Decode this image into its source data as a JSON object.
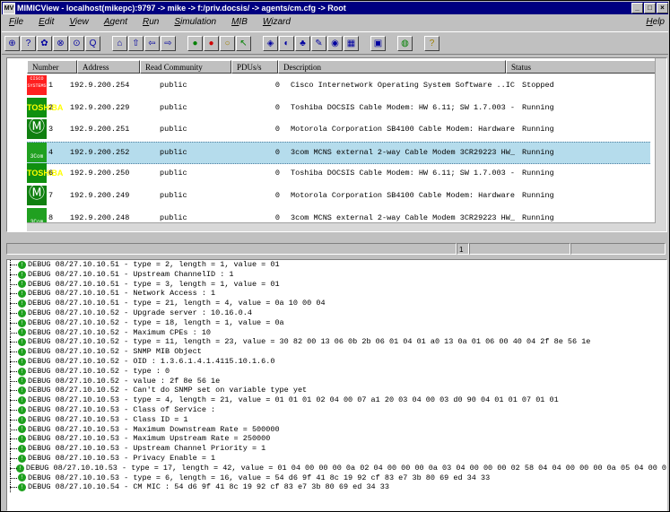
{
  "window": {
    "title": "MIMICView - localhost(mikepc):9797 -> mike -> f:/priv.docsis/ -> agents/cm.cfg -> Root",
    "app_icon": "MV",
    "minimize": "_",
    "maximize": "□",
    "close": "×"
  },
  "menu": [
    "File",
    "Edit",
    "View",
    "Agent",
    "Run",
    "Simulation",
    "MIB",
    "Wizard"
  ],
  "menu_help": "Help",
  "toolbar": [
    {
      "name": "add-icon",
      "glyph": "⊕",
      "cls": "blue"
    },
    {
      "name": "help-circle-icon",
      "glyph": "?",
      "cls": "blue"
    },
    {
      "name": "agent-icon",
      "glyph": "✿",
      "cls": "blue"
    },
    {
      "name": "link-icon",
      "glyph": "⊗",
      "cls": "blue"
    },
    {
      "name": "search-doc-icon",
      "glyph": "⊙",
      "cls": "blue"
    },
    {
      "name": "find-icon",
      "glyph": "Q",
      "cls": "blue"
    },
    {
      "name": "home-icon",
      "glyph": "⌂",
      "cls": "blue",
      "gap": true
    },
    {
      "name": "up-arrow-icon",
      "glyph": "⇧",
      "cls": "blue"
    },
    {
      "name": "back-arrow-icon",
      "glyph": "⇦",
      "cls": "blue"
    },
    {
      "name": "forward-arrow-icon",
      "glyph": "⇨",
      "cls": "blue"
    },
    {
      "name": "start-icon",
      "glyph": "●",
      "cls": "green",
      "gap": true
    },
    {
      "name": "stop-icon",
      "glyph": "●",
      "cls": "red"
    },
    {
      "name": "pause-icon",
      "glyph": "○",
      "cls": "yel"
    },
    {
      "name": "resume-icon",
      "glyph": "↖",
      "cls": "green"
    },
    {
      "name": "mib-browser-icon",
      "glyph": "◈",
      "cls": "blue",
      "gap": true
    },
    {
      "name": "oid-search-icon",
      "glyph": "◐",
      "cls": "blue"
    },
    {
      "name": "trap-icon",
      "glyph": "♣",
      "cls": "blue"
    },
    {
      "name": "value-icon",
      "glyph": "✎",
      "cls": "blue"
    },
    {
      "name": "record-icon",
      "glyph": "◉",
      "cls": "blue"
    },
    {
      "name": "table-icon",
      "glyph": "▦",
      "cls": "blue"
    },
    {
      "name": "log-icon",
      "glyph": "▣",
      "cls": "blue",
      "gap": true
    },
    {
      "name": "pdu-icon",
      "glyph": "◍",
      "cls": "green",
      "gap": true
    },
    {
      "name": "about-icon",
      "glyph": "?",
      "cls": "yel",
      "gap": true
    }
  ],
  "table": {
    "headers": [
      "Number",
      "Address",
      "Read Community",
      "PDUs/s",
      "Description",
      "Status"
    ],
    "rows": [
      {
        "logo": "cisco",
        "logo_text": "CISCO SYSTEMS",
        "number": "1",
        "address": "192.9.200.254",
        "community": "public",
        "pdus": "0",
        "description": "Cisco Internetwork Operating System Software ..IC",
        "status": "Stopped"
      },
      {
        "logo": "tosh",
        "logo_text": "TOSHIBA",
        "number": "2",
        "address": "192.9.200.229",
        "community": "public",
        "pdus": "0",
        "description": "Toshiba DOCSIS Cable Modem: HW 6.11; SW 1.7.003 -",
        "status": "Running"
      },
      {
        "logo": "moto",
        "logo_text": "",
        "number": "3",
        "address": "192.9.200.251",
        "community": "public",
        "pdus": "0",
        "description": "Motorola Corporation SB4100 Cable Modem: Hardware",
        "status": "Running"
      },
      {
        "logo": "3com",
        "logo_text": "3Com",
        "number": "4",
        "address": "192.9.200.252",
        "community": "public",
        "pdus": "0",
        "description": "3com MCNS external 2-way Cable Modem 3CR29223 HW_",
        "status": "Running",
        "selected": true
      },
      {
        "logo": "tosh",
        "logo_text": "TOSHIBA",
        "number": "6",
        "address": "192.9.200.250",
        "community": "public",
        "pdus": "0",
        "description": "Toshiba DOCSIS Cable Modem: HW 6.11; SW 1.7.003 -",
        "status": "Running"
      },
      {
        "logo": "moto",
        "logo_text": "",
        "number": "7",
        "address": "192.9.200.249",
        "community": "public",
        "pdus": "0",
        "description": "Motorola Corporation SB4100 Cable Modem: Hardware",
        "status": "Running"
      },
      {
        "logo": "3com",
        "logo_text": "3Com",
        "number": "8",
        "address": "192.9.200.248",
        "community": "public",
        "pdus": "0",
        "description": "3com MCNS external 2-way Cable Modem 3CR29223 HW_",
        "status": "Running"
      }
    ]
  },
  "status_strip": {
    "cell": "1"
  },
  "log": {
    "marker": "!",
    "lines": [
      "DEBUG 08/27.10.10.51 - type = 2, length = 1, value = 01",
      "DEBUG 08/27.10.10.51 - Upstream ChannelID : 1",
      "DEBUG 08/27.10.10.51 - type = 3, length = 1, value = 01",
      "DEBUG 08/27.10.10.51 - Network Access : 1",
      "DEBUG 08/27.10.10.51 - type = 21, length = 4, value = 0a 10 00 04",
      "DEBUG 08/27.10.10.52 - Upgrade server : 10.16.0.4",
      "DEBUG 08/27.10.10.52 - type = 18, length = 1, value = 0a",
      "DEBUG 08/27.10.10.52 - Maximum CPEs : 10",
      "DEBUG 08/27.10.10.52 - type = 11, length = 23, value = 30 82 00 13 06 0b 2b 06 01 04 01 a0 13 0a 01 06 00 40 04 2f 8e 56 1e",
      "DEBUG 08/27.10.10.52 - SNMP MIB Object",
      "DEBUG 08/27.10.10.52 -   OID : 1.3.6.1.4.1.4115.10.1.6.0",
      "DEBUG 08/27.10.10.52 -   type : 0",
      "DEBUG 08/27.10.10.52 -   value : 2f 8e 56 1e",
      "DEBUG 08/27.10.10.52 -   Can't do SNMP set on variable type  yet",
      "DEBUG 08/27.10.10.53 - type = 4, length = 21, value = 01 01 01 02 04 00 07 a1 20 03 04 00 03 d0 90 04 01 01 07 01 01",
      "DEBUG 08/27.10.10.53 - Class of Service :",
      "DEBUG 08/27.10.10.53 -   Class ID = 1",
      "DEBUG 08/27.10.10.53 -   Maximum Downstream Rate = 500000",
      "DEBUG 08/27.10.10.53 -   Maximum Upstream Rate = 250000",
      "DEBUG 08/27.10.10.53 -   Upstream Channel Priority = 1",
      "DEBUG 08/27.10.10.53 -   Privacy Enable = 1",
      "DEBUG 08/27.10.10.53 - type = 17, length = 42, value = 01 04 00 00 00 0a 02 04 00 00 00 0a 03 04 00 00 00 02 58 04 04 00 00 00 0a 05 04 00 0",
      "DEBUG 08/27.10.10.53 - type = 6, length = 16, value = 54 d6 9f 41 8c 19 92 cf 83 e7 3b 80 69 ed 34 33",
      "DEBUG 08/27.10.10.54 - CM MIC : 54 d6 9f 41 8c 19 92 cf 83 e7 3b 80 69 ed 34 33"
    ]
  }
}
